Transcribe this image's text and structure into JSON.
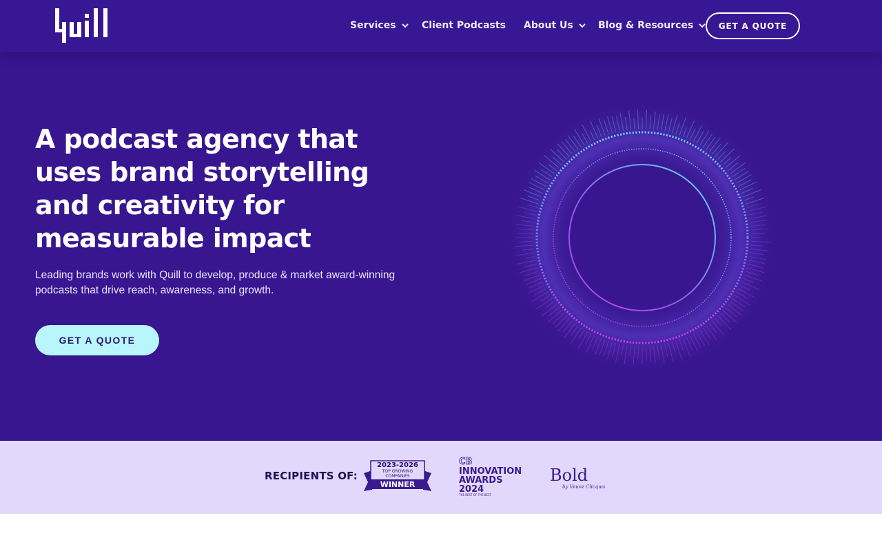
{
  "brand": {
    "logo_name": "Quill wordmark"
  },
  "nav": {
    "items": [
      {
        "label": "Services",
        "has_dropdown": true
      },
      {
        "label": "Client Podcasts",
        "has_dropdown": false
      },
      {
        "label": "About Us",
        "has_dropdown": true
      },
      {
        "label": "Blog & Resources",
        "has_dropdown": true
      }
    ],
    "cta_label": "GET A QUOTE"
  },
  "hero": {
    "headline": "A podcast agency that uses brand storytelling and creativity for measurable impact",
    "subtext": "Leading brands work with Quill to develop, produce & market award-winning podcasts that drive reach, awareness, and growth.",
    "cta_label": "GET A QUOTE"
  },
  "awards": {
    "label": "RECIPIENTS OF:",
    "badges": [
      {
        "line1": "2023-2026",
        "line2": "TOP GROWING",
        "line3": "COMPANIES",
        "line4": "WINNER"
      },
      {
        "line1": "CB",
        "line2": "INNOVATION",
        "line3": "AWARDS",
        "line4": "2024",
        "line5": "THE BEST OF THE BEST"
      },
      {
        "line1": "Bold",
        "line2": "by Veuve Clicquot"
      }
    ]
  },
  "colors": {
    "hero_background": "#381690",
    "awards_background": "#e2d8fb",
    "cta_background": "#b8f6fb",
    "ring_cyan": "#5fe3f2",
    "ring_magenta": "#d83be0",
    "ring_violet": "#8a5cf0"
  },
  "icons": {
    "nav_dropdown": "chevron-down-icon"
  }
}
